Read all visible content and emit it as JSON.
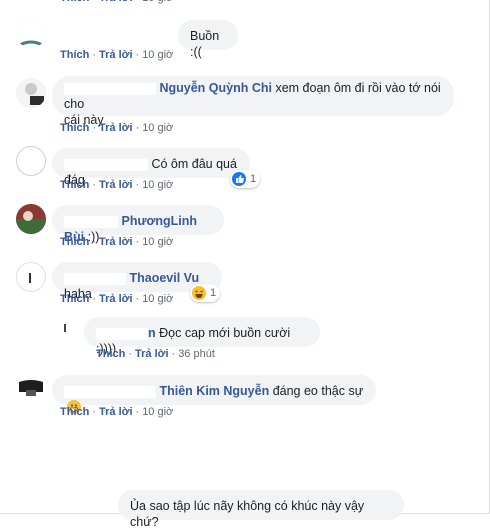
{
  "actions": {
    "like": "Thích",
    "reply": "Trả lời",
    "separator": "·"
  },
  "comments": [
    {
      "name": "",
      "text": "Buồn :((",
      "time": "10 giờ"
    },
    {
      "name": "Nguyễn Quỳnh Chi",
      "text_line1": "xem đoạn ôm đi rồi vào tớ nói cho",
      "text_line2": "cái này",
      "time": "10 giờ"
    },
    {
      "name": "",
      "text": "Có ôm đâu quá đág",
      "time": "10 giờ",
      "reaction_icon": "like-icon",
      "reaction_count": "1"
    },
    {
      "name": "PhươngLinh Bùi",
      "text": ":))",
      "time": "10 giờ"
    },
    {
      "name": "Thaoevil Vu",
      "text": "haha",
      "time": "10 giờ",
      "reaction_icon": "haha-icon",
      "reaction_count": "1"
    },
    {
      "name": "n",
      "text": "Đọc cap mới buồn cười :))))",
      "time": "36 phút"
    },
    {
      "name": "Thiên Kim Nguyễn",
      "text": "đáng eo thậc sự",
      "emoji": "grinning-face-icon",
      "time": "10 giờ"
    },
    {
      "name": "",
      "text": "Ủa sao tập lúc nãy không có khúc này vậy chứ?"
    }
  ]
}
